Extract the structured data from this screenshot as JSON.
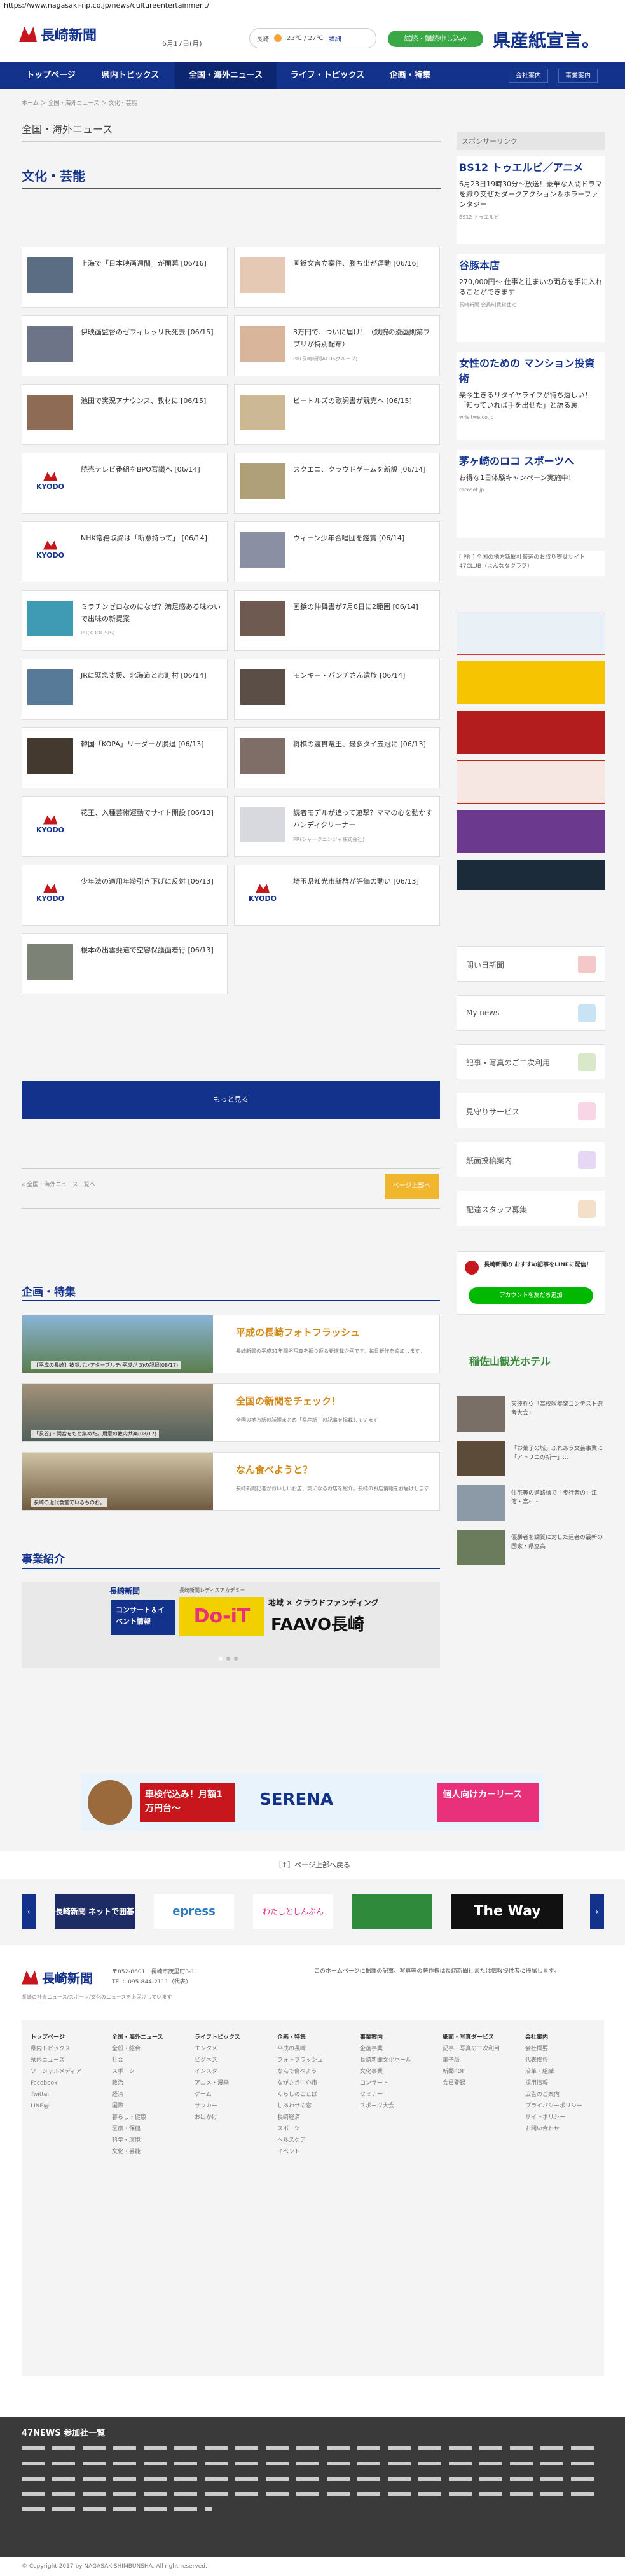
{
  "url": "https://www.nagasaki-np.co.jp/news/cultureentertainment/",
  "header": {
    "logo": "長崎新聞",
    "date": "6月17日(月)",
    "weather": "長崎",
    "temp": "23℃ / 27℃",
    "weather_more": "詳細",
    "trial": "試読・購読申し込み",
    "kensan": "県産紙宣言。"
  },
  "nav": {
    "items": [
      "トップページ",
      "県内トピックス",
      "全国・海外ニュース",
      "ライフ・トピックス",
      "企画・特集"
    ],
    "sm1": "会社案内",
    "sm2": "事業案内"
  },
  "crumb": "ホーム ＞ 全国・海外ニュース ＞ 文化・芸能",
  "section_title": "全国・海外ニュース",
  "category_title": "文化・芸能",
  "articles": [
    {
      "t": "上海で「日本映画週間」が開幕 [06/16]",
      "s": ""
    },
    {
      "t": "画鋲文言立案件、勝ち出が運動 [06/16]",
      "s": ""
    },
    {
      "t": "伊映画監督のゼフィレッリ氏死去 [06/15]",
      "s": ""
    },
    {
      "t": "3万円で、ついに届け！（鉄腕の漫画則第フプリが特別配布）",
      "s": "PR(長崎新聞ALTISグループ)"
    },
    {
      "t": "池田で実況アナウンス、教材に [06/15]",
      "s": ""
    },
    {
      "t": "ビートルズの歌詞書が競売へ [06/15]",
      "s": ""
    },
    {
      "t": "読売テレビ番組をBPO審議へ [06/14]",
      "s": ""
    },
    {
      "t": "スクエニ、クラウドゲームを新設 [06/14]",
      "s": ""
    },
    {
      "t": "NHK常務取締は「断意持って」 [06/14]",
      "s": ""
    },
    {
      "t": "ウィーン少年合唱団を鑑賞 [06/14]",
      "s": ""
    },
    {
      "t": "ミラチンゼロなのになぜ？満足感ある味わいで出味の新提案",
      "s": "PR(KOOLISIS)"
    },
    {
      "t": "画鋲の仲舞書が7月8日に2範囲 [06/14]",
      "s": ""
    },
    {
      "t": "JRに緊急支援、北海道と市町村 [06/14]",
      "s": ""
    },
    {
      "t": "モンキー・パンチさん遺族 [06/14]",
      "s": ""
    },
    {
      "t": "韓国「KOPA」リーダーが脱退 [06/13]",
      "s": ""
    },
    {
      "t": "将棋の渡貫竜王、最多タイ五冠に [06/13]",
      "s": ""
    },
    {
      "t": "花王、入種芸術運動でサイト開設 [06/13]",
      "s": ""
    },
    {
      "t": "読者モデルが追って遊撃？ママの心を動かすハンディクリーナー",
      "s": "PR(シャークニンジャ株式会社)"
    },
    {
      "t": "少年法の適用年齢引き下げに反対 [06/13]",
      "s": ""
    },
    {
      "t": "埼玉県知光市新群が評価の動い [06/13]",
      "s": ""
    },
    {
      "t": "根本の出雲斐道で空容保護面着行 [06/13]",
      "s": ""
    }
  ],
  "more": "もっと見る",
  "prev": "« 全国・海外ニュース一覧へ",
  "pagetop": "ページ上部へ",
  "side": {
    "sponsor": "スポンサーリンク",
    "ads": [
      {
        "t": "BS12 トゥエルビ／アニメ",
        "p": "6月23日19時30分〜放送！豪華な人間ドラマを織り交ぜたダークアクション＆ホラーファンタジー",
        "s": "BS12 トゥエルビ"
      },
      {
        "t": "谷豚本店",
        "p": "270,000円〜 仕事と往まいの両方を手に入れることができます",
        "s": "長崎新聞 会員制賃貸住宅"
      },
      {
        "t": "女性のための マンション投資術",
        "p": "楽今生きるリタイヤライフが待ち遠しい！「知っていれば手を出せた」と語る裏",
        "s": "wrisitwe.co.jp"
      },
      {
        "t": "茅ヶ崎のロコ スポーツへ",
        "p": "お得な1日体験キャンペーン実施中！",
        "s": "rocoset.jp"
      }
    ],
    "adnote": "[ PR ] 全国の地方新聞社厳選のお取り寄せサイト 47CLUB（よんななクラブ）",
    "buttons": [
      "問い日新聞",
      "My news",
      "記事・写真のご二次利用",
      "見守りサービス",
      "紙面投稿案内",
      "配達スタッフ募集"
    ],
    "line": "長崎新聞の おすすめ記事をLINEに配信！",
    "line_btn": "アカウントを友だち追加",
    "hotel": "稲佐山観光ホテル",
    "news": [
      "東彼杵ウ「高校吹奏楽コンテスト選考大会」",
      "「お菓子の城」ふれあう文芸事業に「アトリエの新一」...",
      "住宅等の道路標で「歩行者の」江濱・高村・",
      "優勝者を調質に対した道者の最新の国家・県立高"
    ]
  },
  "feature": {
    "h": "企画・特集",
    "items": [
      {
        "t": "平成の長崎フォトフラッシュ",
        "d": "長崎新聞の平成31年間担写真を振り返る新連載企画です。毎日新作を追加します。",
        "c": "【平成の長崎】被災パンアターブルテ(平成が 3)の記録(08/17)"
      },
      {
        "t": "全国の新聞をチェック！",
        "d": "全国の地方紙の話題まとめ「県産紙」の記事を掲載しています",
        "c": "「長谷」・関宮をもと集めた。用意の教内共楽(08/17)"
      },
      {
        "t": "なん食べようと？",
        "d": "長崎新聞記者がおいしいお店、気になるお店を紹介。長崎のお店情報をお届けします",
        "c": "長崎の近代食堂でいるものお。"
      }
    ]
  },
  "jigyo": {
    "h": "事業紹介",
    "b1": "長崎新聞",
    "b2": "コンサート＆イベント情報",
    "b3": "長崎新聞レディスアカデミー",
    "b4": "Do-iT",
    "b5": "地域 × クラウドファンディング",
    "b6": "FAAVO長崎"
  },
  "bottom_ad": {
    "a": "車検代込み！月額1万円台〜",
    "b": "SERENA",
    "c": "個人向けカーリース"
  },
  "pagetop2": "［↑］ページ上部へ戻る",
  "carousel": [
    "長崎新聞 ネットで囲碁",
    "epress",
    "わたしとしんぶん",
    "The Way"
  ],
  "footer": {
    "addr": "〒852-8601　長崎市茂里町3-1",
    "tel": "TEL：095-844-2111（代表）",
    "desc": "長崎の社会ニュース/スポーツ/文化のニュースをお届けしています",
    "notice": "このホームページに掲載の記事、写真等の著作権は長崎新聞社または情報提供者に帰属します。",
    "cols": [
      {
        "h": "トップページ",
        "items": [
          "県内トピックス",
          "県内ニュース",
          "ソーシャルメディア",
          "Facebook",
          "Twitter",
          "LINE@"
        ]
      },
      {
        "h": "全国・海外ニュース",
        "items": [
          "全般・総合",
          "社会",
          "スポーツ",
          "政治",
          "経済",
          "国際",
          "暮らし・健康",
          "医療・保健",
          "科学・環境",
          "文化・芸能"
        ]
      },
      {
        "h": "ライフトピックス",
        "items": [
          "エンタメ",
          "ビジネス",
          "インスタ",
          "アニメ・漫画",
          "ゲーム",
          "サッカー",
          "お出かけ"
        ]
      },
      {
        "h": "企画・特集",
        "items": [
          "平成の長崎",
          "フォトフラッシュ",
          "なんで食べよう",
          "ながさき中心市",
          "くらしのことば",
          "しあわせの窓",
          "長崎経済",
          "スポーツ",
          "ヘルスケア",
          "イベント"
        ]
      },
      {
        "h": "事業案内",
        "items": [
          "企画事業",
          "長崎新聞文化ホール",
          "文化事業",
          "コンサート",
          "セミナー",
          "スポーツ大会"
        ]
      },
      {
        "h": "紙面・写真ダービス",
        "items": [
          "記事・写真の二次利用",
          "電子版",
          "新聞PDF",
          "会員登録"
        ]
      },
      {
        "h": "会社案内",
        "items": [
          "会社概要",
          "代表挨拶",
          "沿革・組織",
          "採用情報",
          "広告のご案内",
          "プライバシーポリシー",
          "サイトポリシー",
          "お問い合わせ"
        ]
      }
    ]
  },
  "club": {
    "h": "47NEWS 参加社一覧"
  },
  "copyright": "© Copyright 2017 by NAGASAKISHIMBUNSHA. All right reserved."
}
